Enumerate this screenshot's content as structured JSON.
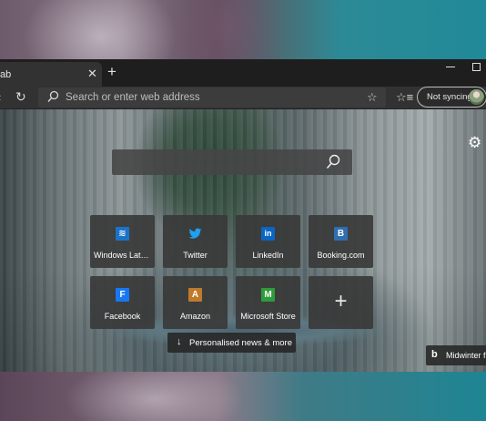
{
  "tab": {
    "title": "ab",
    "close": "✕",
    "new_tab": "+"
  },
  "toolbar": {
    "back": "‹",
    "refresh": "↻",
    "address_placeholder": "Search or enter web address",
    "favorite_star": "☆",
    "favorites": "☆≡",
    "sync_label": "Not syncing"
  },
  "new_tab_page": {
    "settings": "⚙",
    "search_placeholder": "",
    "tiles": [
      {
        "label": "Windows Late...",
        "icon": "windows-latest-icon",
        "color": "#1a73c9",
        "glyph": "≋"
      },
      {
        "label": "Twitter",
        "icon": "twitter-icon",
        "color": "#1da1f2",
        "glyph": "🐦"
      },
      {
        "label": "LinkedIn",
        "icon": "linkedin-icon",
        "color": "#0a66c2",
        "glyph": "in"
      },
      {
        "label": "Booking.com",
        "icon": "booking-icon",
        "color": "#2f6fb0",
        "glyph": "B"
      },
      {
        "label": "Facebook",
        "icon": "facebook-icon",
        "color": "#1877f2",
        "glyph": "F"
      },
      {
        "label": "Amazon",
        "icon": "amazon-icon",
        "color": "#c07a2c",
        "glyph": "A"
      },
      {
        "label": "Microsoft Store",
        "icon": "microsoft-store-icon",
        "color": "#2f9c3a",
        "glyph": "M"
      },
      {
        "label": "",
        "icon": "add-tile-icon",
        "glyph": "+"
      }
    ],
    "news_button": {
      "arrow": "↓",
      "label": "Personalised news & more"
    },
    "image_credit": {
      "icon": "b",
      "label": "Midwinter fr"
    }
  }
}
